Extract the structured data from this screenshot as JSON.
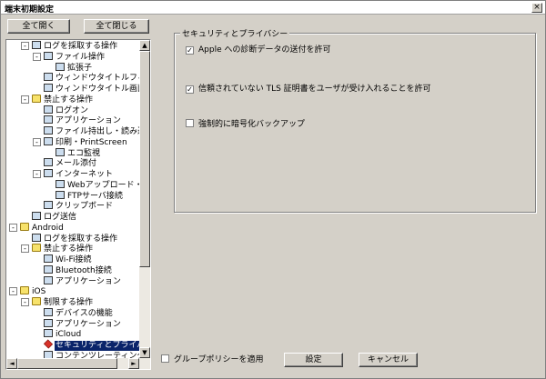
{
  "window": {
    "title": "端末初期設定",
    "close_glyph": "×"
  },
  "buttons": {
    "expand_all": "全て開く",
    "collapse_all": "全て閉じる",
    "settings": "設定",
    "cancel": "キャンセル"
  },
  "group_policy": {
    "label": "グループポリシーを適用",
    "checked": false
  },
  "security": {
    "group_title": "セキュリティとプライバシー",
    "options": [
      {
        "label": "Apple への診断データの送付を許可",
        "checked": true
      },
      {
        "label": "信頼されていない TLS 証明書をユーザが受け入れることを許可",
        "checked": true
      },
      {
        "label": "強制的に暗号化バックアップ",
        "checked": false
      }
    ]
  },
  "tree": [
    {
      "label": "ログを採取する操作",
      "icon": "doc-icon",
      "exp": "-"
    },
    {
      "label": "ファイル操作",
      "icon": "doc-icon",
      "exp": "-"
    },
    {
      "label": "拡張子",
      "icon": "doc-icon",
      "exp": ""
    },
    {
      "label": "ウィンドウタイトルフィル",
      "icon": "doc-icon",
      "exp": ""
    },
    {
      "label": "ウィンドウタイトル画面キ",
      "icon": "doc-icon",
      "exp": ""
    },
    {
      "label": "禁止する操作",
      "icon": "folder-icon",
      "exp": "-"
    },
    {
      "label": "ログオン",
      "icon": "doc-icon",
      "exp": ""
    },
    {
      "label": "アプリケーション",
      "icon": "doc-icon",
      "exp": ""
    },
    {
      "label": "ファイル持出し・読み込",
      "icon": "doc-icon",
      "exp": ""
    },
    {
      "label": "印刷・PrintScreen",
      "icon": "doc-icon",
      "exp": "-"
    },
    {
      "label": "エコ監視",
      "icon": "doc-icon",
      "exp": ""
    },
    {
      "label": "メール添付",
      "icon": "doc-icon",
      "exp": ""
    },
    {
      "label": "インターネット",
      "icon": "doc-icon",
      "exp": "-"
    },
    {
      "label": "Webアップロード・ダ",
      "icon": "doc-icon",
      "exp": ""
    },
    {
      "label": "FTPサーバ接続",
      "icon": "doc-icon",
      "exp": ""
    },
    {
      "label": "クリップボード",
      "icon": "doc-icon",
      "exp": ""
    },
    {
      "label": "ログ送信",
      "icon": "doc-icon",
      "exp": ""
    },
    {
      "label": "Android",
      "icon": "folder-icon",
      "exp": "-"
    },
    {
      "label": "ログを採取する操作",
      "icon": "doc-icon",
      "exp": ""
    },
    {
      "label": "禁止する操作",
      "icon": "folder-icon",
      "exp": "-"
    },
    {
      "label": "Wi-Fi接続",
      "icon": "doc-icon",
      "exp": ""
    },
    {
      "label": "Bluetooth接続",
      "icon": "doc-icon",
      "exp": ""
    },
    {
      "label": "アプリケーション",
      "icon": "doc-icon",
      "exp": ""
    },
    {
      "label": "iOS",
      "icon": "folder-icon",
      "exp": "-"
    },
    {
      "label": "制限する操作",
      "icon": "folder-icon",
      "exp": "-"
    },
    {
      "label": "デバイスの機能",
      "icon": "doc-icon",
      "exp": ""
    },
    {
      "label": "アプリケーション",
      "icon": "doc-icon",
      "exp": ""
    },
    {
      "label": "iCloud",
      "icon": "doc-icon",
      "exp": ""
    },
    {
      "label": "セキュリティとプライバシ",
      "icon": "diamond-icon",
      "exp": "",
      "selected": true
    },
    {
      "label": "コンテンツレーティング",
      "icon": "doc-icon",
      "exp": ""
    }
  ],
  "scroll": {
    "up": "▲",
    "down": "▼",
    "left": "◄",
    "right": "►"
  }
}
